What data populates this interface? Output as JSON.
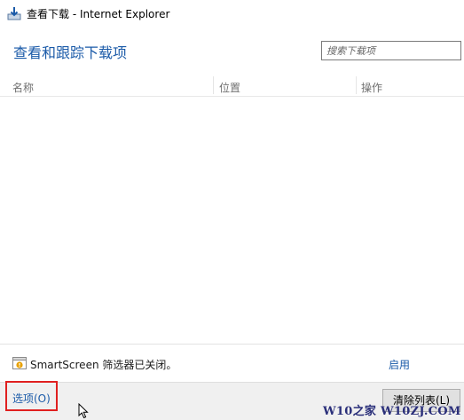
{
  "window": {
    "title": "查看下载 - Internet Explorer",
    "icon": "download-arrow-icon"
  },
  "header": {
    "heading": "查看和跟踪下载项",
    "search_placeholder": "搜索下载项"
  },
  "columns": [
    "名称",
    "位置",
    "操作"
  ],
  "downloads": [],
  "smartscreen": {
    "icon": "shield-warning-icon",
    "message": "SmartScreen 筛选器已关闭。",
    "enable_label": "启用"
  },
  "footer": {
    "options_label": "选项(O)",
    "clear_list_label": "清除列表(L)"
  },
  "watermark": "W10之家 W10ZJ.COM",
  "colors": {
    "link": "#1a5aa8",
    "highlight_box": "#e02020",
    "footer_bg": "#f0f0f0"
  }
}
